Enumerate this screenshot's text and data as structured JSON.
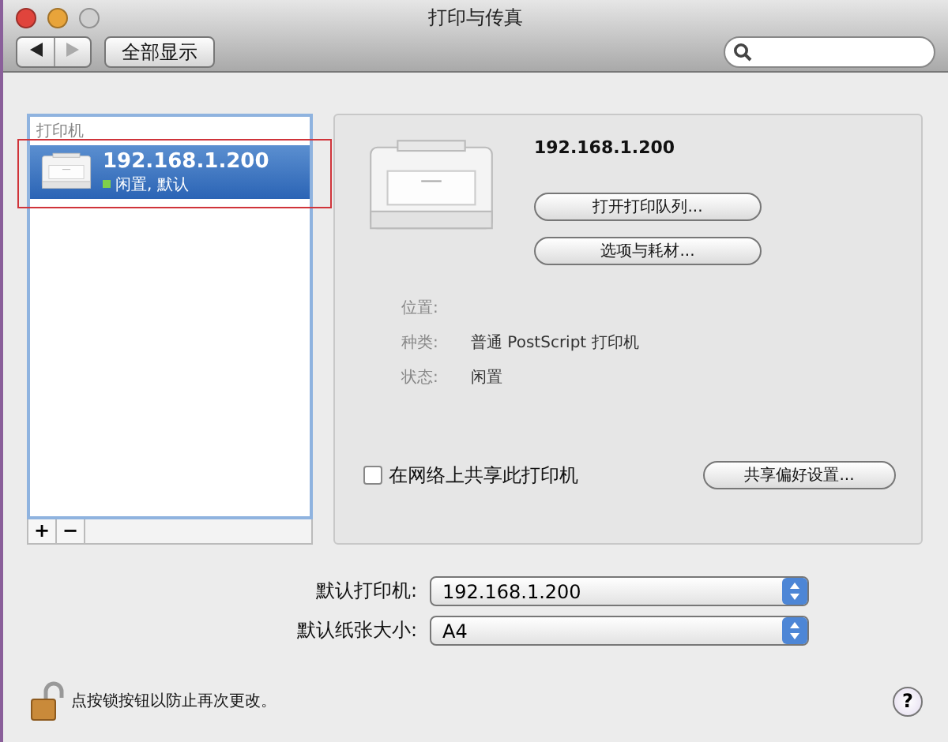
{
  "window": {
    "title": "打印与传真"
  },
  "toolbar": {
    "back_disabled": false,
    "forward_disabled": true,
    "show_all": "全部显示"
  },
  "printers": {
    "header": "打印机",
    "items": [
      {
        "name": "192.168.1.200",
        "status": "闲置, 默认",
        "color": "#7fd04a",
        "selected": true,
        "highlighted": true
      }
    ]
  },
  "list_buttons": [
    "+",
    "−"
  ],
  "detail": {
    "name": "192.168.1.200",
    "buttons": [
      "打开打印队列...",
      "选项与耗材..."
    ],
    "info": [
      {
        "label": "位置:"
      },
      {
        "label": "种类:",
        "value": "普通 PostScript 打印机"
      },
      {
        "label": "状态:",
        "value": "闲置"
      }
    ]
  },
  "share": {
    "label": "在网络上共享此打印机",
    "checked": false,
    "button": "共享偏好设置..."
  },
  "defaults": [
    {
      "label": "默认打印机:",
      "value": "192.168.1.200"
    },
    {
      "label": "默认纸张大小:",
      "value": "A4"
    }
  ],
  "lock": {
    "text": "点按锁按钮以防止再次更改。",
    "locked": false
  },
  "help": "?"
}
